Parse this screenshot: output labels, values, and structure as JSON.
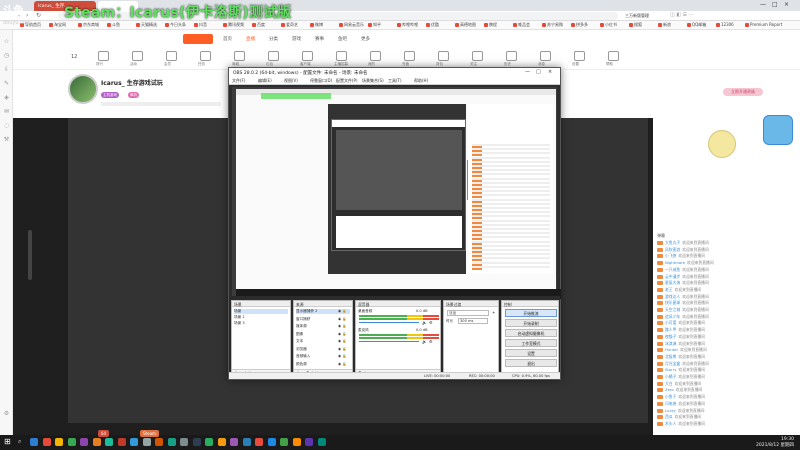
{
  "overlay": {
    "title": "Steam：Icarus(伊卡洛斯)测试版",
    "logo": "斗鱼",
    "logo_sub": "douyu.com"
  },
  "browser": {
    "tabs": [
      {
        "label": "Icarus_ 生存…",
        "active": false
      },
      {
        "label": "",
        "active": true
      }
    ],
    "window_controls": [
      "—",
      "□",
      "×"
    ],
    "right_tools": [
      "三万新版管理"
    ],
    "bookmarks": [
      "导航首页",
      "淘宝网",
      "京东商城",
      "斗鱼",
      "天猫精选",
      "今日头条",
      "抖音",
      "腾讯视频",
      "百度",
      "爱奇艺",
      "微博",
      "网易云音乐",
      "知乎",
      "哔哩哔哩",
      "优酷",
      "高德地图",
      "携程",
      "唯品会",
      "苏宁易购",
      "拼多多",
      "小红书",
      "搜狐",
      "新浪",
      "QQ邮箱",
      "12306",
      "Premium Report"
    ]
  },
  "site_nav": {
    "items": [
      "首页",
      "直播",
      "分类",
      "游戏",
      "赛事",
      "鱼吧",
      "更多"
    ],
    "icon_labels": [
      "排行",
      "活动",
      "会员",
      "任务",
      "商城",
      "礼包",
      "客户端",
      "主播招募",
      "我的",
      "充值",
      "背包",
      "关注",
      "历史",
      "消息",
      "设置",
      "帮助"
    ]
  },
  "streamer": {
    "name": "Icarus_ 生存游戏试玩",
    "room_no": "12",
    "tags": [
      "主机游戏",
      "单机"
    ]
  },
  "right_panel": {
    "top_button": "立即开通贵族",
    "chat_title": "弹幕",
    "rows": [
      {
        "name": "大鱼丸子",
        "text": "欢迎来到直播间"
      },
      {
        "name": "风吹麦浪",
        "text": "欢迎来到直播间"
      },
      {
        "name": "小飞侠",
        "text": "欢迎来到直播间"
      },
      {
        "name": "Nightmare",
        "text": "欢迎来到直播间"
      },
      {
        "name": "一只咸鱼",
        "text": "欢迎来到直播间"
      },
      {
        "name": "云中漫步",
        "text": "欢迎来到直播间"
      },
      {
        "name": "星辰大海",
        "text": "欢迎来到直播间"
      },
      {
        "name": "老王",
        "text": "欢迎来到直播间"
      },
      {
        "name": "游戏达人",
        "text": "欢迎来到直播间"
      },
      {
        "name": "快乐星球",
        "text": "欢迎来到直播间"
      },
      {
        "name": "天空之城",
        "text": "欢迎来到直播间"
      },
      {
        "name": "追风少年",
        "text": "欢迎来到直播间"
      },
      {
        "name": "小可爱",
        "text": "欢迎来到直播间"
      },
      {
        "name": "路人甲",
        "text": "欢迎来到直播间"
      },
      {
        "name": "夜猫子",
        "text": "欢迎来到直播间"
      },
      {
        "name": "冰淇淋",
        "text": "欢迎来到直播间"
      },
      {
        "name": "Hunter",
        "text": "欢迎来到直播间"
      },
      {
        "name": "北极熊",
        "text": "欢迎来到直播间"
      },
      {
        "name": "月光宝盒",
        "text": "欢迎来到直播间"
      },
      {
        "name": "Starry",
        "text": "欢迎来到直播间"
      },
      {
        "name": "小橘子",
        "text": "欢迎来到直播间"
      },
      {
        "name": "大白",
        "text": "欢迎来到直播间"
      },
      {
        "name": "Zero",
        "text": "欢迎来到直播间"
      },
      {
        "name": "小鱼干",
        "text": "欢迎来到直播间"
      },
      {
        "name": "闪电侠",
        "text": "欢迎来到直播间"
      },
      {
        "name": "Lucky",
        "text": "欢迎来到直播间"
      },
      {
        "name": "西瓜",
        "text": "欢迎来到直播间"
      },
      {
        "name": "木头人",
        "text": "欢迎来到直播间"
      }
    ]
  },
  "obs": {
    "title": "OBS 28.0.2 (64-bit, windows) - 配置文件: 未命名 - 场景: 未命名",
    "menu": [
      "文件(F)",
      "编辑(E)",
      "视图(V)",
      "停靠窗口(D)",
      "配置文件(P)",
      "场景集合(S)",
      "工具(T)",
      "帮助(H)"
    ],
    "docks": {
      "scenes": {
        "title": "场景",
        "items": [
          "场景",
          "场景 2",
          "场景 3"
        ]
      },
      "sources": {
        "title": "来源",
        "items": [
          "显示器捕获 2",
          "窗口捕获",
          "媒体源",
          "图像",
          "文本",
          "浏览器",
          "音频输入",
          "颜色源"
        ]
      },
      "mixer": {
        "title": "混音器",
        "channels": [
          {
            "name": "桌面音频",
            "level": "0.0 dB"
          },
          {
            "name": "麦克风",
            "level": "0.0 dB"
          }
        ]
      },
      "transitions": {
        "title": "场景过渡",
        "type": "淡出",
        "duration_label": "时长",
        "duration": "300 ms"
      },
      "controls": {
        "title": "控制",
        "buttons": [
          "开始推流",
          "开始录制",
          "启动虚拟摄像机",
          "工作室模式",
          "设置",
          "退出"
        ]
      }
    },
    "status": {
      "live": "LIVE: 00:00:00",
      "rec": "REC: 00:00:00",
      "cpu": "CPU: 0.9%, 60.00 fps"
    }
  },
  "taskbar": {
    "time": "19:30",
    "date": "2021/8/12 星期四"
  },
  "bottom_tags": [
    "64",
    "Steam"
  ],
  "colors": {
    "accent": "#f07d2f",
    "brand": "#ff5d23",
    "overlay_text": "#5fe05f",
    "chat_name": "#3a8fd8"
  }
}
